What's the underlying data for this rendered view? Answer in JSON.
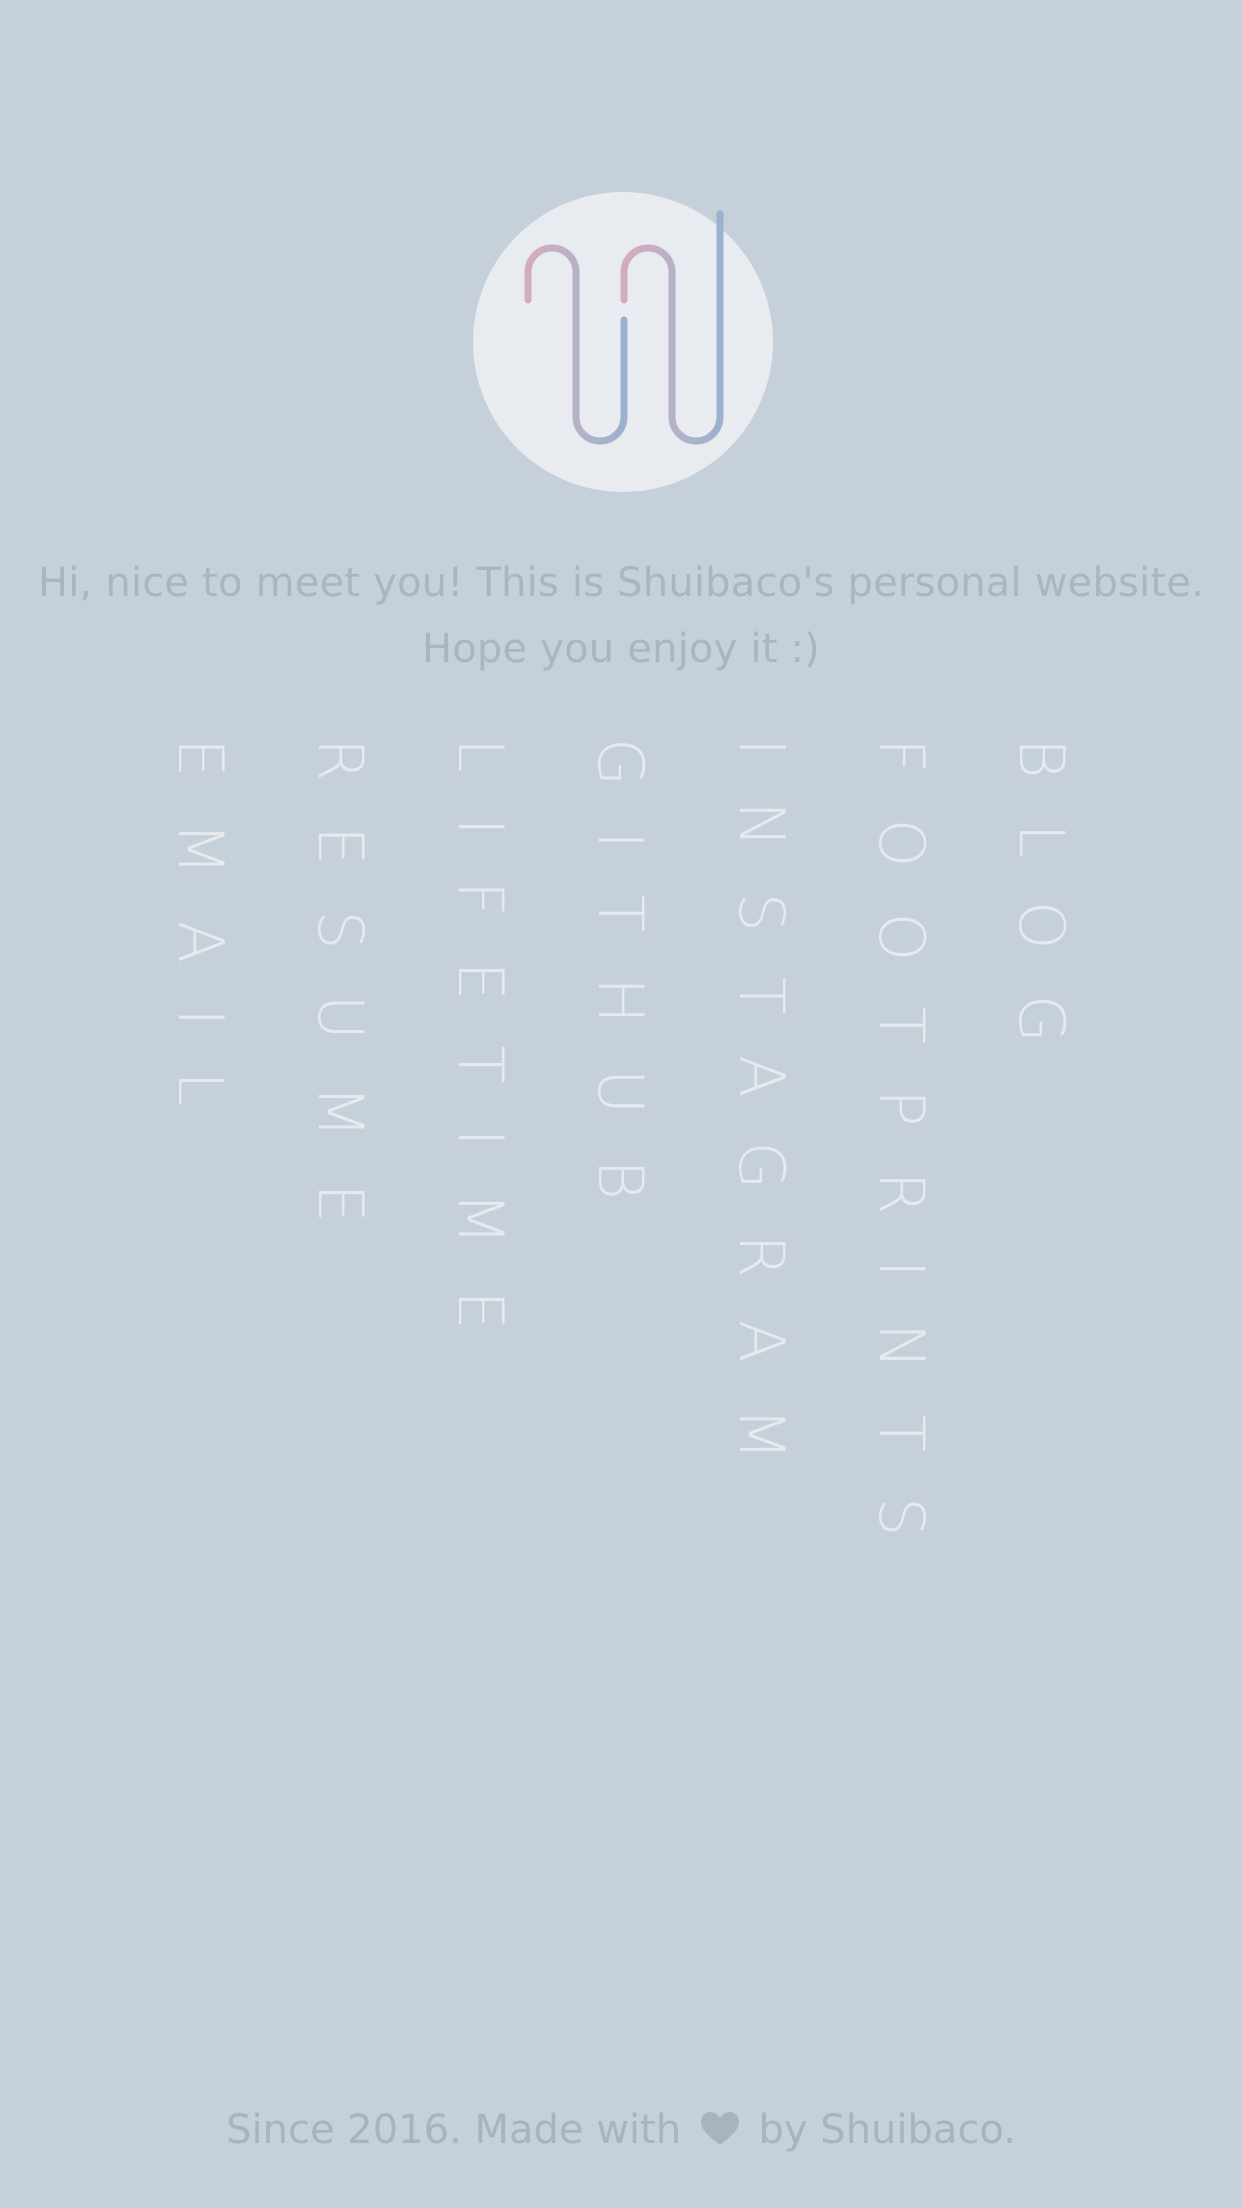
{
  "logo": {
    "icon": "shuibaco-monogram-logo",
    "colors": [
      "#d3aebc",
      "#b5b0c9",
      "#9fb1cc"
    ]
  },
  "intro": {
    "line1": "Hi, nice to meet you! This is Shuibaco's personal website.",
    "line2": "Hope you enjoy it :)"
  },
  "nav": {
    "items": [
      {
        "label": "BLOG"
      },
      {
        "label": "FOOTPRINTS"
      },
      {
        "label": "INSTAGRAM"
      },
      {
        "label": "GITHUB"
      },
      {
        "label": "LIFETIME"
      },
      {
        "label": "RESUME"
      },
      {
        "label": "EMAIL"
      }
    ]
  },
  "footer": {
    "text_before": "Since 2016. Made with",
    "heart_icon": "heart-icon",
    "text_after": "by Shuibaco."
  },
  "colors": {
    "background": "#c5d0da",
    "logo_circle": "#e8ebef",
    "nav_text": "#e6e9ee",
    "body_text": "#a9b6c1"
  }
}
